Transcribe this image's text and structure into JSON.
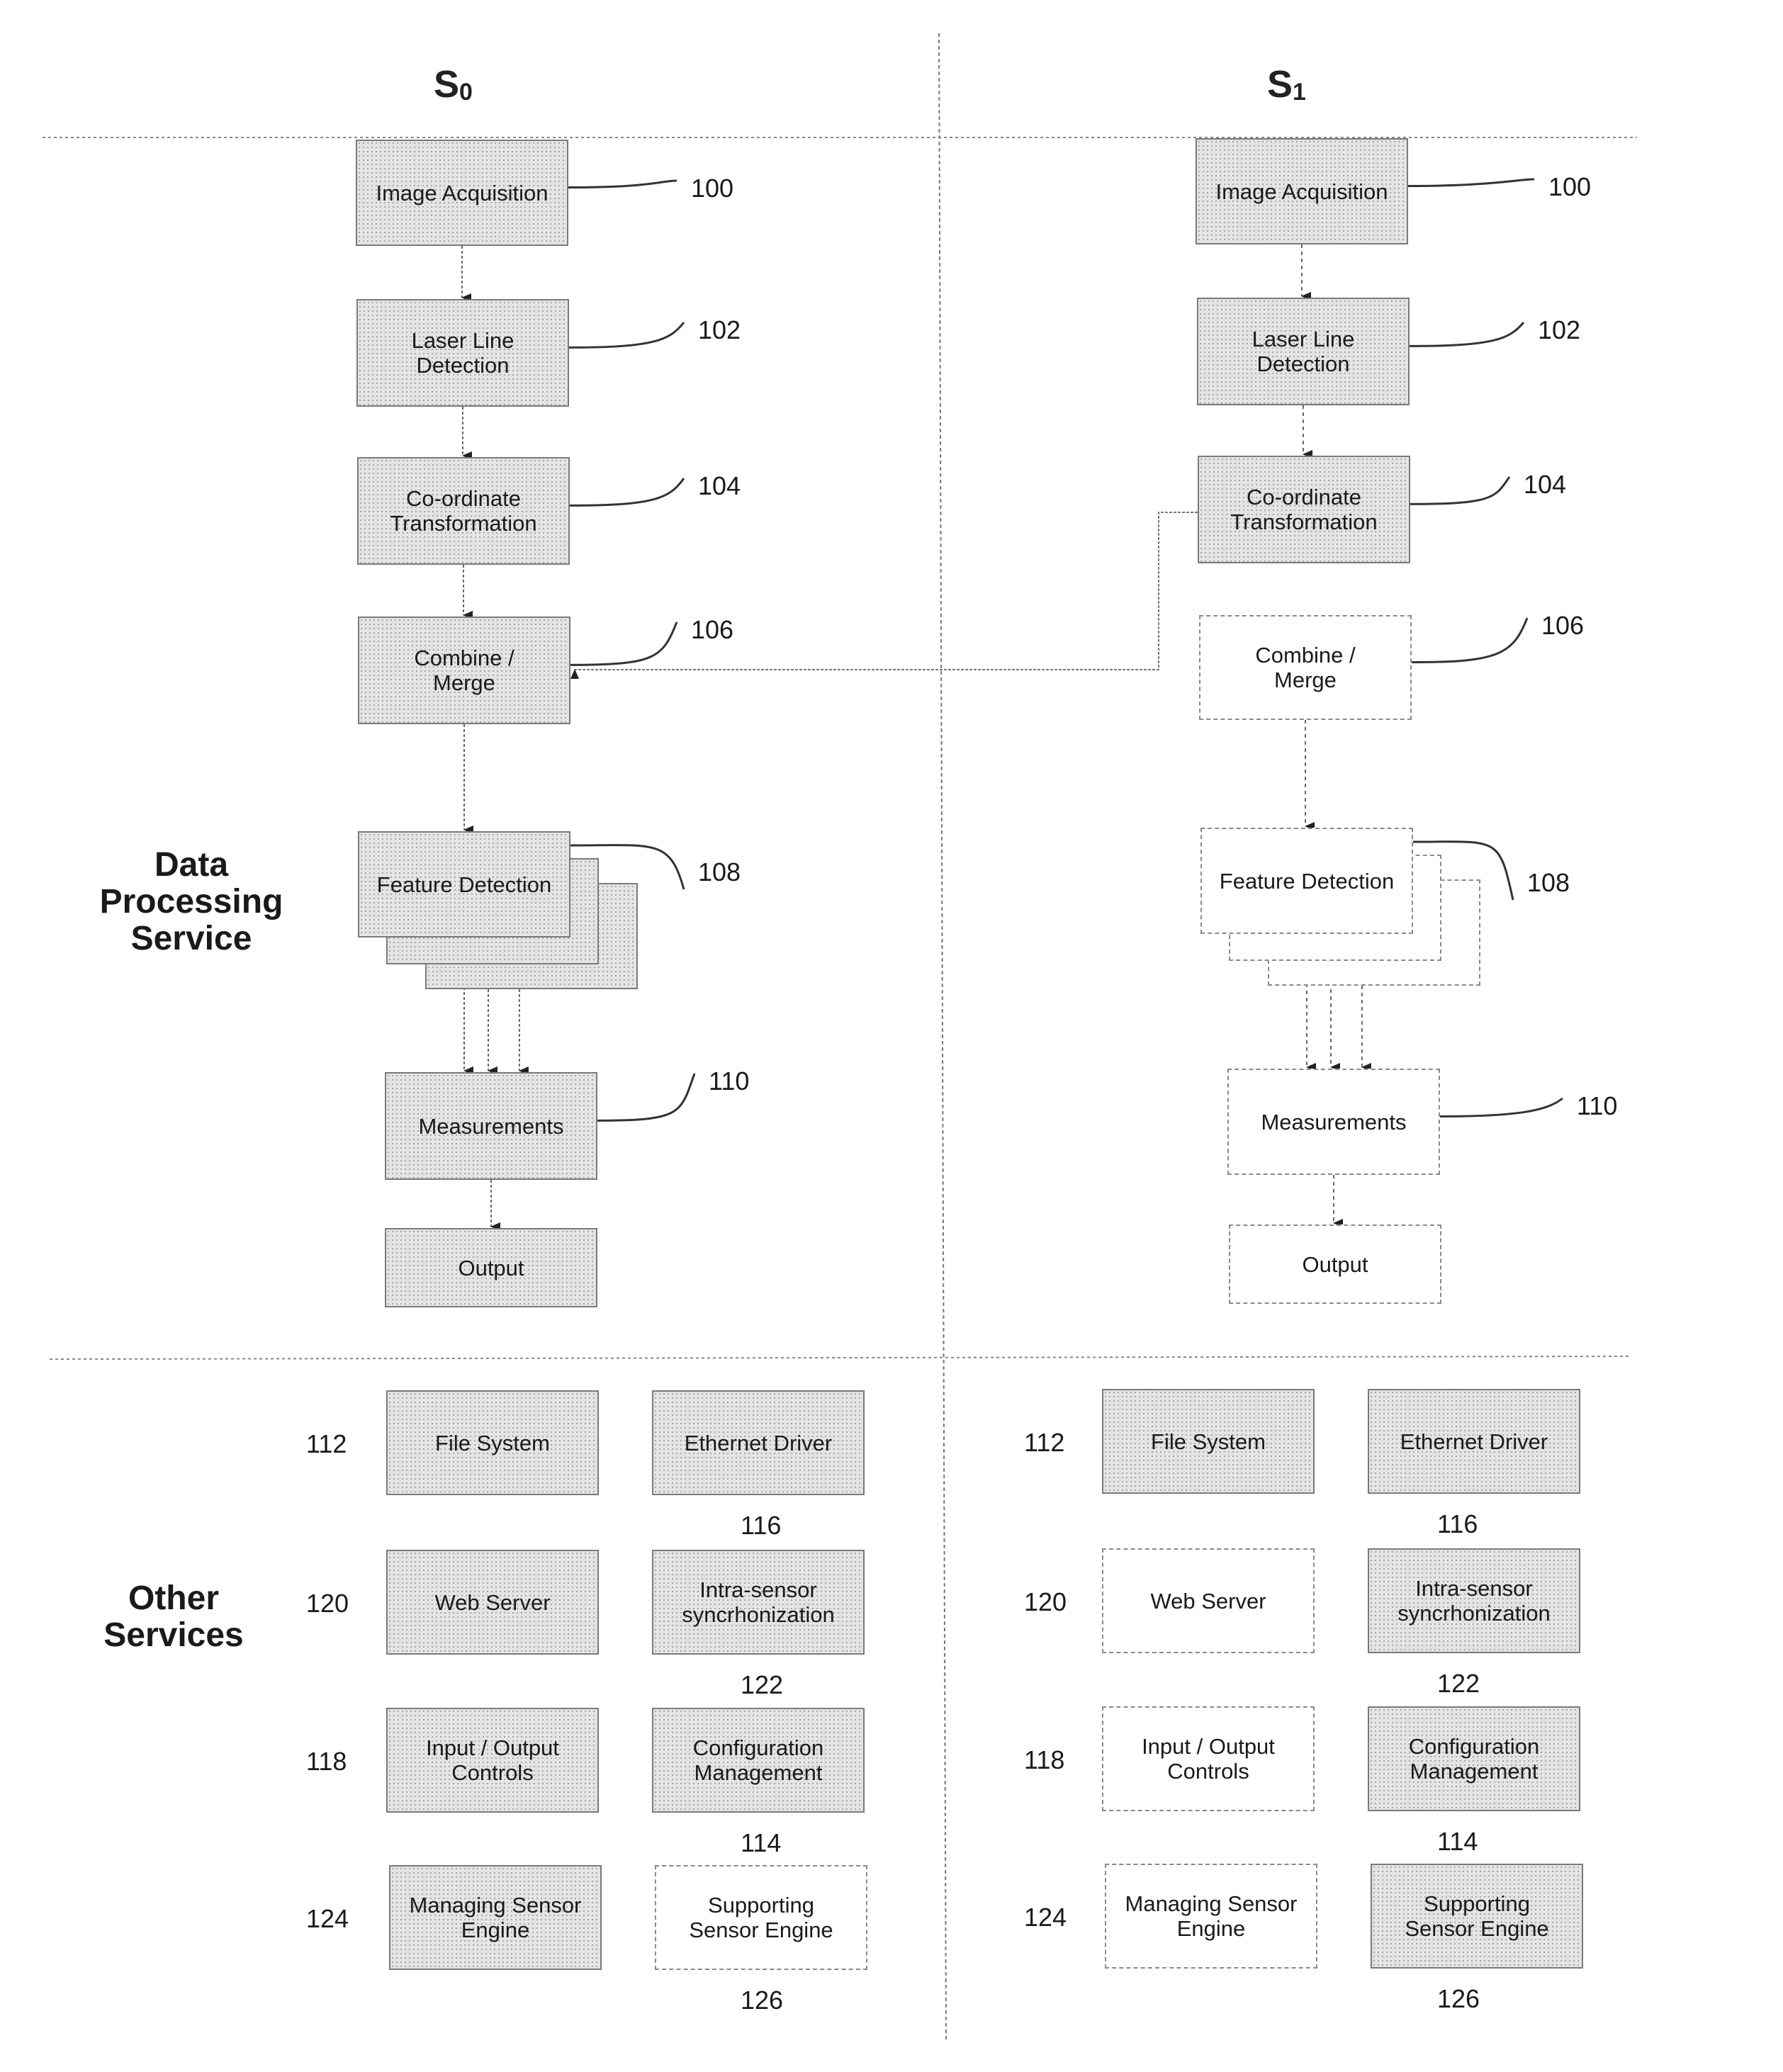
{
  "columns": [
    {
      "id": "s0",
      "letter": "S",
      "subscript": "0"
    },
    {
      "id": "s1",
      "letter": "S",
      "subscript": "1"
    }
  ],
  "sections": {
    "data_processing": "Data\nProcessing\nService",
    "other_services": "Other\nServices"
  },
  "pipeline": {
    "s0": [
      {
        "key": "image_acquisition",
        "label": "Image Acquisition",
        "ref": "100",
        "style": "solid"
      },
      {
        "key": "laser_line_detection",
        "label": "Laser Line\nDetection",
        "ref": "102",
        "style": "solid"
      },
      {
        "key": "coordinate_transformation",
        "label": "Co-ordinate\nTransformation",
        "ref": "104",
        "style": "solid"
      },
      {
        "key": "combine_merge",
        "label": "Combine /\nMerge",
        "ref": "106",
        "style": "solid"
      },
      {
        "key": "feature_detection",
        "label": "Feature Detection",
        "ref": "108",
        "style": "solid"
      },
      {
        "key": "measurements",
        "label": "Measurements",
        "ref": "110",
        "style": "solid"
      },
      {
        "key": "output",
        "label": "Output",
        "ref": "",
        "style": "solid"
      }
    ],
    "s1": [
      {
        "key": "image_acquisition",
        "label": "Image Acquisition",
        "ref": "100",
        "style": "solid"
      },
      {
        "key": "laser_line_detection",
        "label": "Laser Line\nDetection",
        "ref": "102",
        "style": "solid"
      },
      {
        "key": "coordinate_transformation",
        "label": "Co-ordinate\nTransformation",
        "ref": "104",
        "style": "solid"
      },
      {
        "key": "combine_merge",
        "label": "Combine /\nMerge",
        "ref": "106",
        "style": "dashed"
      },
      {
        "key": "feature_detection",
        "label": "Feature Detection",
        "ref": "108",
        "style": "dashed"
      },
      {
        "key": "measurements",
        "label": "Measurements",
        "ref": "110",
        "style": "dashed"
      },
      {
        "key": "output",
        "label": "Output",
        "ref": "",
        "style": "dashed"
      }
    ]
  },
  "services": {
    "s0": [
      {
        "label": "File System",
        "ref": "112",
        "style": "solid"
      },
      {
        "label": "Ethernet Driver",
        "ref": "116",
        "style": "solid"
      },
      {
        "label": "Web Server",
        "ref": "120",
        "style": "solid"
      },
      {
        "label": "Intra-sensor\nsyncrhonization",
        "ref": "122",
        "style": "solid"
      },
      {
        "label": "Input / Output\nControls",
        "ref": "118",
        "style": "solid"
      },
      {
        "label": "Configuration\nManagement",
        "ref": "114",
        "style": "solid"
      },
      {
        "label": "Managing Sensor\nEngine",
        "ref": "124",
        "style": "solid"
      },
      {
        "label": "Supporting\nSensor Engine",
        "ref": "126",
        "style": "dashed"
      }
    ],
    "s1": [
      {
        "label": "File System",
        "ref": "112",
        "style": "solid"
      },
      {
        "label": "Ethernet Driver",
        "ref": "116",
        "style": "solid"
      },
      {
        "label": "Web Server",
        "ref": "120",
        "style": "dashed"
      },
      {
        "label": "Intra-sensor\nsyncrhonization",
        "ref": "122",
        "style": "solid"
      },
      {
        "label": "Input / Output\nControls",
        "ref": "118",
        "style": "dashed"
      },
      {
        "label": "Configuration\nManagement",
        "ref": "114",
        "style": "solid"
      },
      {
        "label": "Managing Sensor\nEngine",
        "ref": "124",
        "style": "dashed"
      },
      {
        "label": "Supporting\nSensor Engine",
        "ref": "126",
        "style": "solid"
      }
    ]
  }
}
